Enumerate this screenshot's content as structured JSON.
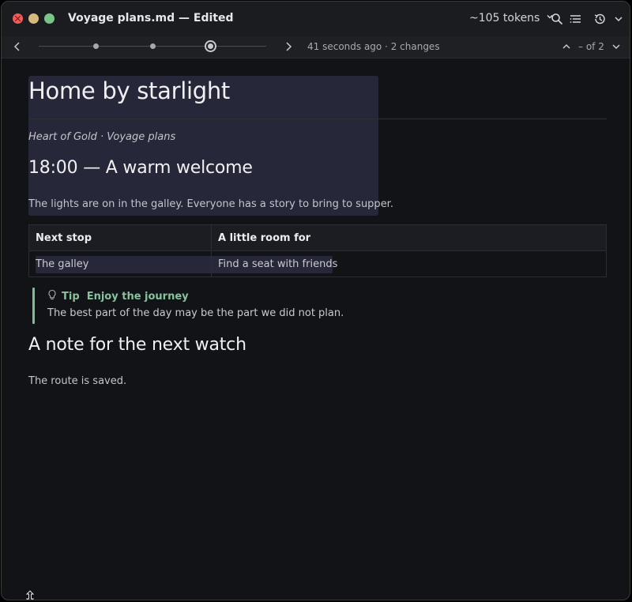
{
  "window": {
    "title": "Voyage plans.md — Edited",
    "tokens": "~105 tokens"
  },
  "toolbar": {
    "icons": [
      "search-icon",
      "outline-icon",
      "history-icon",
      "chevron-down-icon"
    ]
  },
  "history": {
    "status": "41 seconds ago · 2 changes",
    "match_counter": "– of 2"
  },
  "document": {
    "title": "Home by starlight",
    "subtitle": "Heart of Gold · Voyage plans",
    "section1_heading": "18:00 — A warm welcome",
    "section1_text": "The lights are on in the galley. Everyone has a story to bring to supper.",
    "table": {
      "headers": [
        "Next stop",
        "A little room for"
      ],
      "rows": [
        [
          "The galley",
          "Find a seat with friends"
        ]
      ]
    },
    "tip": {
      "label": "Tip",
      "title": "Enjoy the journey",
      "text": "The best part of the day may be the part we did not plan."
    },
    "section2_heading": "A note for the next watch",
    "section2_text": "The route is saved."
  },
  "colors": {
    "background": "#121317",
    "highlight": "#262839",
    "tip_accent": "#7dbf93"
  }
}
